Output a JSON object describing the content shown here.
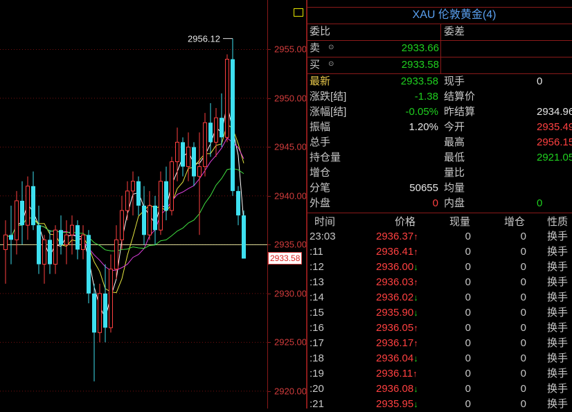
{
  "chart": {
    "high_label": "2956.12",
    "current_tag": "2933.58",
    "axis_labels": [
      "2955.00",
      "2950.00",
      "2945.00",
      "2940.00",
      "2935.00",
      "2930.00",
      "2925.00",
      "2920.00"
    ],
    "colors": {
      "up": "#ff4040",
      "down": "#3ee0f0",
      "ma_white": "#ffffff",
      "ma_yellow": "#e8e840",
      "ma_magenta": "#e040e0",
      "ma_green": "#40e040",
      "ref_line": "#e8e8a0"
    }
  },
  "chart_data": {
    "type": "candlestick",
    "ylim": [
      2918.5,
      2959.5
    ],
    "y_ticks": [
      2955,
      2950,
      2945,
      2940,
      2935,
      2930,
      2925,
      2920
    ],
    "reference_price": 2935.0,
    "candles": [
      {
        "o": 2934.5,
        "h": 2937.5,
        "l": 2931.0,
        "c": 2936.0
      },
      {
        "o": 2936.0,
        "h": 2939.0,
        "l": 2933.0,
        "c": 2935.5
      },
      {
        "o": 2935.5,
        "h": 2940.5,
        "l": 2934.0,
        "c": 2939.5
      },
      {
        "o": 2939.5,
        "h": 2941.5,
        "l": 2935.0,
        "c": 2937.0
      },
      {
        "o": 2937.0,
        "h": 2942.0,
        "l": 2935.5,
        "c": 2941.0
      },
      {
        "o": 2941.0,
        "h": 2942.5,
        "l": 2936.5,
        "c": 2937.0
      },
      {
        "o": 2937.0,
        "h": 2939.0,
        "l": 2932.0,
        "c": 2933.0
      },
      {
        "o": 2933.0,
        "h": 2936.0,
        "l": 2931.0,
        "c": 2935.5
      },
      {
        "o": 2935.5,
        "h": 2936.5,
        "l": 2932.0,
        "c": 2933.0
      },
      {
        "o": 2933.0,
        "h": 2937.0,
        "l": 2932.0,
        "c": 2936.5
      },
      {
        "o": 2936.5,
        "h": 2938.0,
        "l": 2934.0,
        "c": 2935.0
      },
      {
        "o": 2935.0,
        "h": 2937.5,
        "l": 2933.0,
        "c": 2936.0
      },
      {
        "o": 2936.0,
        "h": 2938.0,
        "l": 2934.0,
        "c": 2937.0
      },
      {
        "o": 2937.0,
        "h": 2937.5,
        "l": 2933.5,
        "c": 2934.5
      },
      {
        "o": 2934.5,
        "h": 2937.0,
        "l": 2933.5,
        "c": 2936.0
      },
      {
        "o": 2936.0,
        "h": 2936.5,
        "l": 2929.0,
        "c": 2930.0
      },
      {
        "o": 2930.0,
        "h": 2931.0,
        "l": 2921.0,
        "c": 2926.0
      },
      {
        "o": 2926.0,
        "h": 2931.0,
        "l": 2925.0,
        "c": 2930.0
      },
      {
        "o": 2930.0,
        "h": 2933.0,
        "l": 2925.0,
        "c": 2926.5
      },
      {
        "o": 2926.5,
        "h": 2934.0,
        "l": 2926.0,
        "c": 2932.5
      },
      {
        "o": 2932.5,
        "h": 2937.0,
        "l": 2931.5,
        "c": 2935.5
      },
      {
        "o": 2935.5,
        "h": 2940.0,
        "l": 2934.5,
        "c": 2938.5
      },
      {
        "o": 2938.5,
        "h": 2941.5,
        "l": 2937.5,
        "c": 2940.5
      },
      {
        "o": 2940.5,
        "h": 2942.5,
        "l": 2938.0,
        "c": 2941.5
      },
      {
        "o": 2941.5,
        "h": 2942.0,
        "l": 2938.0,
        "c": 2939.0
      },
      {
        "o": 2939.0,
        "h": 2941.0,
        "l": 2935.0,
        "c": 2936.0
      },
      {
        "o": 2936.0,
        "h": 2940.5,
        "l": 2935.5,
        "c": 2939.0
      },
      {
        "o": 2939.0,
        "h": 2940.0,
        "l": 2935.0,
        "c": 2936.5
      },
      {
        "o": 2936.5,
        "h": 2942.5,
        "l": 2936.0,
        "c": 2941.5
      },
      {
        "o": 2941.5,
        "h": 2943.0,
        "l": 2937.5,
        "c": 2938.5
      },
      {
        "o": 2938.5,
        "h": 2944.0,
        "l": 2938.0,
        "c": 2943.5
      },
      {
        "o": 2943.5,
        "h": 2947.0,
        "l": 2941.5,
        "c": 2945.5
      },
      {
        "o": 2945.5,
        "h": 2946.0,
        "l": 2942.0,
        "c": 2943.0
      },
      {
        "o": 2943.0,
        "h": 2946.5,
        "l": 2941.5,
        "c": 2945.0
      },
      {
        "o": 2945.0,
        "h": 2945.5,
        "l": 2941.0,
        "c": 2942.0
      },
      {
        "o": 2942.0,
        "h": 2946.5,
        "l": 2936.0,
        "c": 2943.0
      },
      {
        "o": 2943.0,
        "h": 2948.5,
        "l": 2942.0,
        "c": 2947.5
      },
      {
        "o": 2947.5,
        "h": 2949.5,
        "l": 2944.0,
        "c": 2945.5
      },
      {
        "o": 2945.5,
        "h": 2949.0,
        "l": 2944.0,
        "c": 2948.0
      },
      {
        "o": 2948.0,
        "h": 2950.5,
        "l": 2945.0,
        "c": 2946.0
      },
      {
        "o": 2946.0,
        "h": 2954.5,
        "l": 2945.5,
        "c": 2954.0
      },
      {
        "o": 2954.0,
        "h": 2956.12,
        "l": 2940.0,
        "c": 2940.5
      },
      {
        "o": 2940.5,
        "h": 2941.0,
        "l": 2937.0,
        "c": 2938.0
      },
      {
        "o": 2938.0,
        "h": 2938.5,
        "l": 2933.58,
        "c": 2933.58
      }
    ]
  },
  "panel": {
    "title": "XAU 伦敦黄金(4)",
    "weibi_label": "委比",
    "weicha_label": "委差",
    "sell_label": "卖",
    "sell_value": "2933.66",
    "buy_label": "买",
    "buy_value": "2933.58",
    "rows": [
      {
        "l1": "最新",
        "v1": "2933.58",
        "l2": "现手",
        "v2": "0"
      },
      {
        "l1": "涨跌[结]",
        "v1": "-1.38",
        "l2": "结算价",
        "v2": ""
      },
      {
        "l1": "涨幅[结]",
        "v1": "-0.05%",
        "l2": "昨结算",
        "v2": "2934.96"
      },
      {
        "l1": "振幅",
        "v1": "1.20%",
        "l2": "今开",
        "v2": "2935.49"
      },
      {
        "l1": "总手",
        "v1": "",
        "l2": "最高",
        "v2": "2956.15"
      },
      {
        "l1": "持仓量",
        "v1": "",
        "l2": "最低",
        "v2": "2921.05"
      },
      {
        "l1": "增仓",
        "v1": "",
        "l2": "量比",
        "v2": ""
      },
      {
        "l1": "分笔",
        "v1": "50655",
        "l2": "均量",
        "v2": ""
      },
      {
        "l1": "外盘",
        "v1": "0",
        "l2": "内盘",
        "v2": "0"
      }
    ],
    "tick_headers": {
      "time": "时间",
      "price": "价格",
      "vol": "现量",
      "oi": "增仓",
      "nature": "性质"
    },
    "ticks": [
      {
        "time": "23:03",
        "price": "2936.37",
        "dir": "up",
        "vol": "0",
        "oi": "0",
        "nature": "换手"
      },
      {
        "time": ":11",
        "price": "2936.41",
        "dir": "up",
        "vol": "0",
        "oi": "0",
        "nature": "换手"
      },
      {
        "time": ":12",
        "price": "2936.00",
        "dir": "down",
        "vol": "0",
        "oi": "0",
        "nature": "换手"
      },
      {
        "time": ":13",
        "price": "2936.03",
        "dir": "up",
        "vol": "0",
        "oi": "0",
        "nature": "换手"
      },
      {
        "time": ":14",
        "price": "2936.02",
        "dir": "down",
        "vol": "0",
        "oi": "0",
        "nature": "换手"
      },
      {
        "time": ":15",
        "price": "2935.90",
        "dir": "down",
        "vol": "0",
        "oi": "0",
        "nature": "换手"
      },
      {
        "time": ":16",
        "price": "2936.05",
        "dir": "up",
        "vol": "0",
        "oi": "0",
        "nature": "换手"
      },
      {
        "time": ":17",
        "price": "2936.17",
        "dir": "up",
        "vol": "0",
        "oi": "0",
        "nature": "换手"
      },
      {
        "time": ":18",
        "price": "2936.04",
        "dir": "down",
        "vol": "0",
        "oi": "0",
        "nature": "换手"
      },
      {
        "time": ":19",
        "price": "2936.11",
        "dir": "up",
        "vol": "0",
        "oi": "0",
        "nature": "换手"
      },
      {
        "time": ":20",
        "price": "2936.08",
        "dir": "down",
        "vol": "0",
        "oi": "0",
        "nature": "换手"
      },
      {
        "time": ":21",
        "price": "2935.95",
        "dir": "down",
        "vol": "0",
        "oi": "0",
        "nature": "换手"
      }
    ]
  }
}
